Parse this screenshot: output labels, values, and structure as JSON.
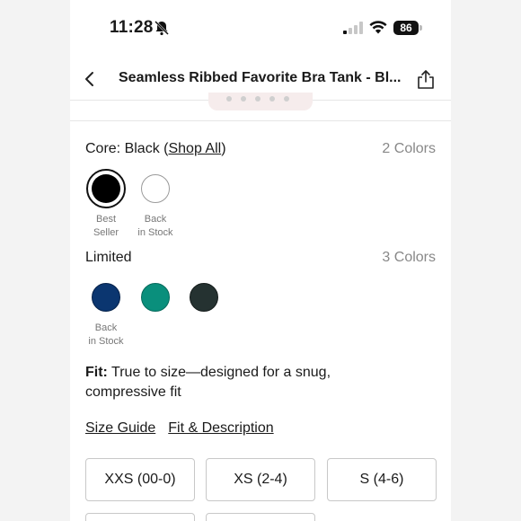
{
  "status_bar": {
    "time": "11:28",
    "battery": "86"
  },
  "nav": {
    "title": "Seamless Ribbed Favorite Bra Tank - Bl..."
  },
  "core": {
    "label_prefix": "Core: Black (",
    "shop_all": "Shop All",
    "label_suffix": ")",
    "count": "2 Colors",
    "swatches": [
      {
        "color": "#000000",
        "caption_line1": "Best",
        "caption_line2": "Seller"
      },
      {
        "color": "#ffffff",
        "caption_line1": "Back",
        "caption_line2": "in Stock"
      }
    ]
  },
  "limited": {
    "label": "Limited",
    "count": "3 Colors",
    "swatches": [
      {
        "color": "#0b3670",
        "caption_line1": "Back",
        "caption_line2": "in Stock"
      },
      {
        "color": "#0a8f7c"
      },
      {
        "color": "#253231"
      }
    ]
  },
  "fit": {
    "label": "Fit:",
    "text": " True to size—designed for a snug, compressive fit"
  },
  "links": {
    "size_guide": "Size Guide",
    "fit_description": "Fit & Description"
  },
  "sizes": [
    "XXS (00-0)",
    "XS (2-4)",
    "S (4-6)",
    "",
    ""
  ]
}
